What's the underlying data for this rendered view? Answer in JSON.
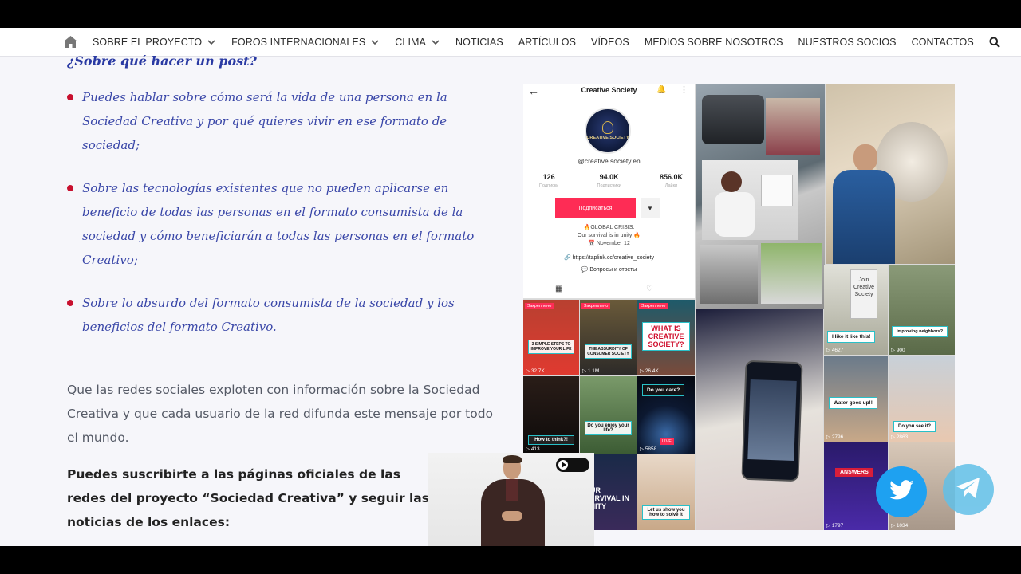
{
  "nav": {
    "items": [
      {
        "label": "SOBRE EL PROYECTO",
        "dropdown": true
      },
      {
        "label": "FOROS INTERNACIONALES",
        "dropdown": true
      },
      {
        "label": "CLIMA",
        "dropdown": true
      },
      {
        "label": "NOTICIAS",
        "dropdown": false
      },
      {
        "label": "ARTÍCULOS",
        "dropdown": false
      },
      {
        "label": "VÍDEOS",
        "dropdown": false
      },
      {
        "label": "MEDIOS SOBRE NOSOTROS",
        "dropdown": false
      },
      {
        "label": "NUESTROS SOCIOS",
        "dropdown": false
      },
      {
        "label": "CONTACTOS",
        "dropdown": false
      }
    ],
    "icons": {
      "home": "home-icon",
      "search": "search-icon"
    }
  },
  "content": {
    "heading": "¿Sobre qué hacer un post?",
    "bullets": [
      "Puedes hablar sobre cómo será la vida de una persona en la Sociedad Creativa y por qué quieres vivir en ese formato de sociedad;",
      "Sobre las tecnologías existentes que no pueden aplicarse en beneficio de todas las personas en el formato consumista de la sociedad y cómo beneficiarán a todas las personas en el formato Creativo;",
      "Sobre lo absurdo del formato consumista de la sociedad y los beneficios del formato Creativo."
    ],
    "paragraph": "Que las redes sociales exploten con información sobre la Sociedad Creativa y que cada usuario de la red difunda este mensaje por todo el mundo.",
    "subscribe": "Puedes suscribirte a las páginas oficiales de las redes del proyecto “Sociedad Creativa” y seguir las noticias de los enlaces:"
  },
  "profile": {
    "name": "Creative Society",
    "avatar_text": "CREATIVE SOCIETY",
    "handle": "@creative.society.en",
    "stats": [
      {
        "num": "126",
        "label": "Подписки"
      },
      {
        "num": "94.0K",
        "label": "Подписчики"
      },
      {
        "num": "856.0K",
        "label": "Лайки"
      }
    ],
    "subscribe_button": "Подписаться",
    "bio_lines": [
      "🔥GLOBAL CRISIS.",
      "Our survival is in unity 🔥",
      "📅 November 12"
    ],
    "link": "🔗 https://taplink.cc/creative_society",
    "qa": "💬 Вопросы и ответы"
  },
  "tiles": {
    "pinned_label": "Закреплено",
    "captions": {
      "t1": "3 SIMPLE STEPS TO IMPROVE YOUR LIFE",
      "t2": "THE ABSURDITY OF CONSUMER SOCIETY",
      "t3": "WHAT IS CREATIVE SOCIETY?",
      "t4": "How to think?!",
      "t5": "Do you enjoy your life?",
      "t6": "Do you care?",
      "t7": "OUR SURVIVAL IN UNITY",
      "t8": "Let us show you how to solve it",
      "t9": "I like it like this!",
      "t10": "Improving neighbors?",
      "t11": "Water goes up!!",
      "t12": "Do you see it?",
      "t13": "ANSWERS",
      "t14": "Join Creative Society"
    },
    "views": {
      "t1": "32.7K",
      "t2": "1.1M",
      "t3": "26.4K",
      "t4": "413",
      "t6": "5858",
      "t9": "4627",
      "t10": "900",
      "t11": "2796",
      "t12": "2863",
      "t13": "1797",
      "t14": "1034"
    },
    "live_label": "LIVE"
  },
  "social": {
    "twitter": "twitter-icon",
    "telegram": "telegram-icon"
  },
  "colors": {
    "accent_blue": "#3a47a8",
    "bullet_red": "#c8102e",
    "tiktok_red": "#fe2c55",
    "twitter": "#1ea1f1",
    "telegram": "#61c0e8"
  }
}
